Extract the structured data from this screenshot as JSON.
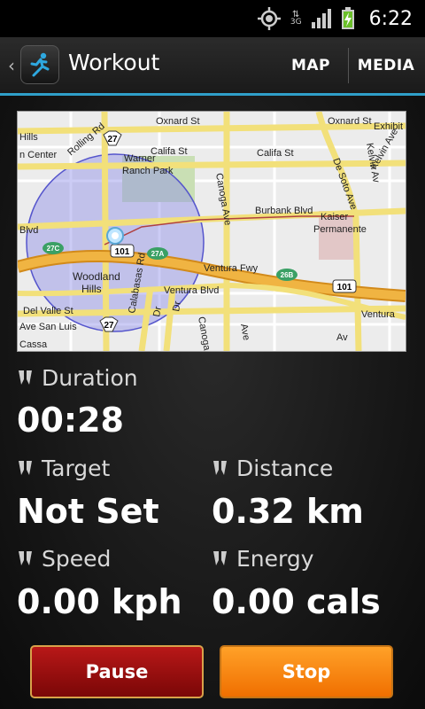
{
  "status_bar": {
    "time": "6:22",
    "network_type": "3G",
    "icons": [
      "gps-icon",
      "3g-data-icon",
      "signal-icon",
      "battery-charging-icon"
    ]
  },
  "action_bar": {
    "title": "Workout",
    "app_icon": "runner-icon",
    "tabs": [
      {
        "label": "MAP"
      },
      {
        "label": "MEDIA"
      }
    ]
  },
  "map": {
    "streets": [
      "Oxnard St",
      "Oxnard St",
      "Exhibit",
      "Califa St",
      "Califa St",
      "Burbank Blvd",
      "Ventura Fwy",
      "Ventura Blvd",
      "Ventura",
      "Del Valle St",
      "Canoga Ave",
      "De Soto Ave",
      "Kelvin Av",
      "Kelvin Ave",
      "Rolling Rd",
      "Calabasas Rd",
      "Blvd",
      "Dr",
      "Dr",
      "Canoga",
      "Ave San Luis",
      "Cassa",
      "Ave",
      "Av"
    ],
    "places": [
      "Warner Ranch Park",
      "Woodland Hills",
      "Kaiser Permanente",
      "Hills",
      "n Center"
    ],
    "shields": [
      "27",
      "27",
      "101",
      "101",
      "27C",
      "27A",
      "26B"
    ]
  },
  "stats": {
    "duration": {
      "label": "Duration",
      "value": "00:28"
    },
    "target": {
      "label": "Target",
      "value": "Not Set"
    },
    "distance": {
      "label": "Distance",
      "value": "0.32 km"
    },
    "speed": {
      "label": "Speed",
      "value": "0.00 kph"
    },
    "energy": {
      "label": "Energy",
      "value": "0.00 cals"
    }
  },
  "buttons": {
    "pause": "Pause",
    "stop": "Stop"
  },
  "colors": {
    "accent": "#2f9fc9",
    "pause": "#a30f0f",
    "stop": "#ff8a12",
    "map_area": "#7e7ee0",
    "map_highway": "#f0b442",
    "map_street": "#f2e07a"
  }
}
